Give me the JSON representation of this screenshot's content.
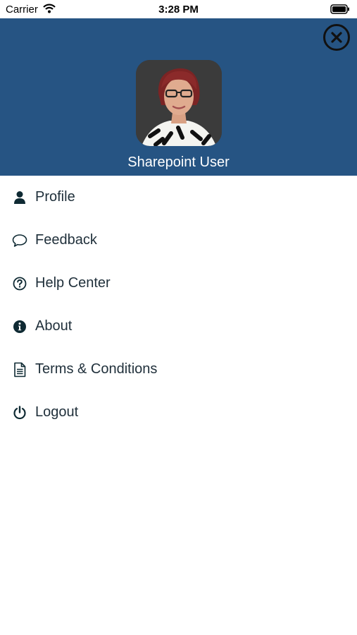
{
  "status_bar": {
    "carrier": "Carrier",
    "time": "3:28 PM"
  },
  "header": {
    "user_name": "Sharepoint User",
    "background_color": "#265483"
  },
  "menu": {
    "items": [
      {
        "label": "Profile",
        "icon": "user-icon"
      },
      {
        "label": "Feedback",
        "icon": "speech-bubble-icon"
      },
      {
        "label": "Help Center",
        "icon": "question-circle-icon"
      },
      {
        "label": "About",
        "icon": "info-circle-icon"
      },
      {
        "label": "Terms & Conditions",
        "icon": "document-icon"
      },
      {
        "label": "Logout",
        "icon": "power-icon"
      }
    ]
  }
}
